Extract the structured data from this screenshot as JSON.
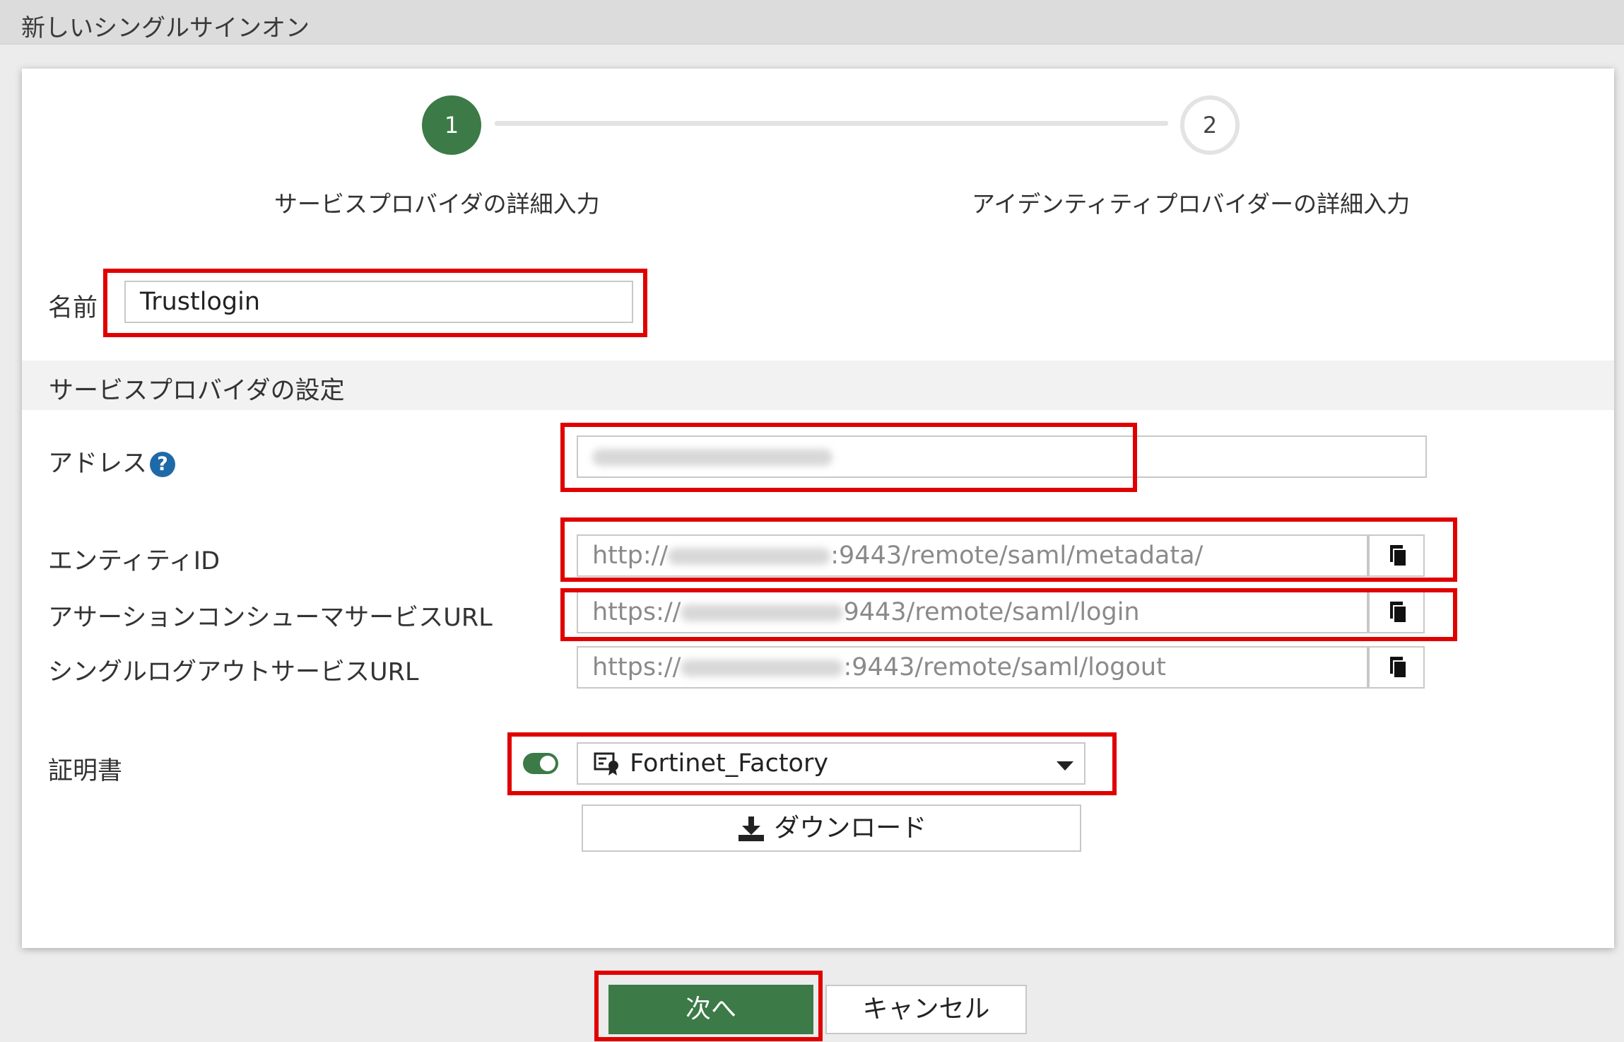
{
  "window": {
    "title": "新しいシングルサインオン"
  },
  "wizard": {
    "steps": [
      {
        "number": "1",
        "label": "サービスプロバイダの詳細入力",
        "state": "active"
      },
      {
        "number": "2",
        "label": "アイデンティティプロバイダーの詳細入力",
        "state": "pending"
      }
    ]
  },
  "form": {
    "name_label": "名前",
    "name_value": "Trustlogin",
    "section_title": "サービスプロバイダの設定",
    "address_label": "アドレス",
    "address_help_icon": "question-circle-icon",
    "entity_id_label": "エンティティID",
    "entity_id_prefix": "http://",
    "entity_id_suffix": ":9443/remote/saml/metadata/",
    "acs_url_label": "アサーションコンシューマサービスURL",
    "acs_url_prefix": "https://",
    "acs_url_suffix": "9443/remote/saml/login",
    "slo_url_label": "シングルログアウトサービスURL",
    "slo_url_prefix": "https://",
    "slo_url_suffix": ":9443/remote/saml/logout",
    "copy_icon": "copy-icon",
    "certificate_label": "証明書",
    "certificate_toggle": "on",
    "certificate_value": "Fortinet_Factory",
    "certificate_icon": "certificate-icon",
    "download_label": "ダウンロード",
    "download_icon": "download-icon"
  },
  "footer": {
    "next_label": "次へ",
    "cancel_label": "キャンセル"
  },
  "colors": {
    "accent_green": "#3c7a47",
    "highlight_red": "#e00000",
    "help_blue": "#1e6aa8"
  }
}
